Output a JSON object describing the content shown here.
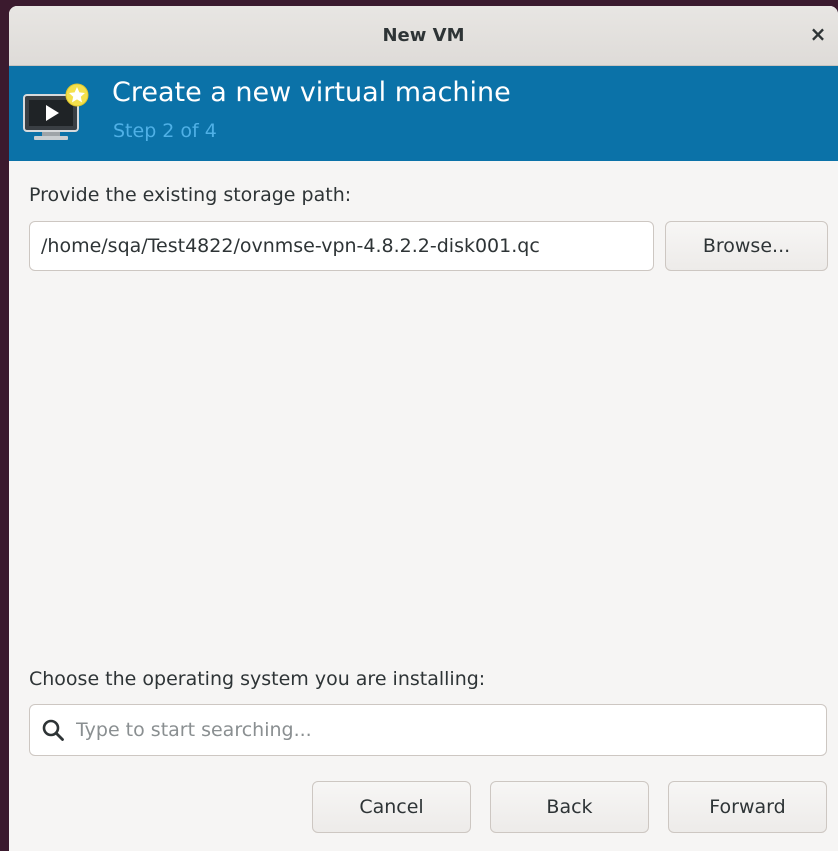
{
  "window": {
    "title": "New VM",
    "close_glyph": "×"
  },
  "banner": {
    "icon": "virtual-machine-icon",
    "heading": "Create a new virtual machine",
    "step": "Step 2 of 4"
  },
  "storage": {
    "label": "Provide the existing storage path:",
    "path_value": "/home/sqa/Test4822/ovnmse-vpn-4.8.2.2-disk001.qc",
    "browse_label": "Browse..."
  },
  "os": {
    "label": "Choose the operating system you are installing:",
    "search_placeholder": "Type to start searching...",
    "search_icon": "search-icon"
  },
  "footer": {
    "cancel_label": "Cancel",
    "back_label": "Back",
    "forward_label": "Forward"
  },
  "colors": {
    "banner_bg": "#0b72a8",
    "step_text": "#4fb0e6",
    "window_bg": "#f6f5f4"
  }
}
